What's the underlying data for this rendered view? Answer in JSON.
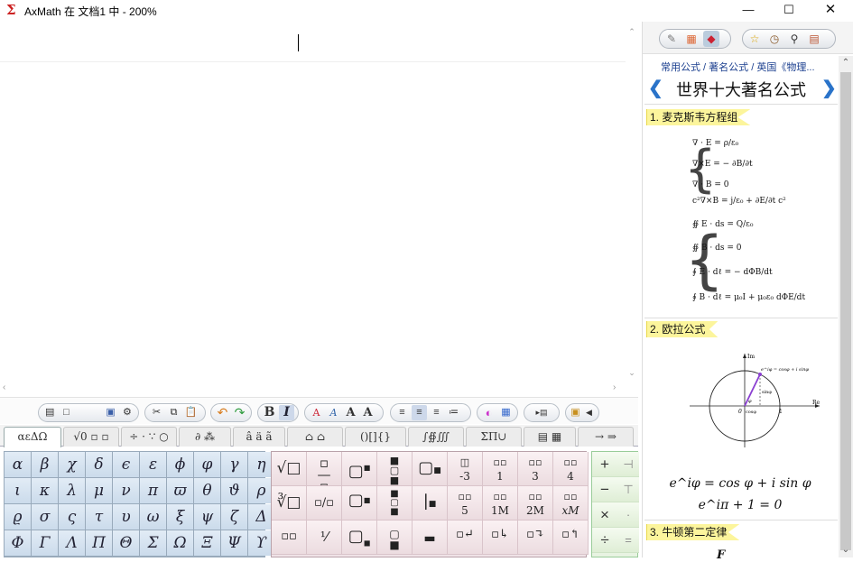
{
  "window": {
    "title": "AxMath 在 文档1 中 - 200%",
    "app_icon": "sigma-icon",
    "controls": [
      "minimize",
      "maximize",
      "close"
    ]
  },
  "toolbar": {
    "bold_label": "B",
    "italic_label": "I",
    "font_buttons": [
      "A",
      "A",
      "A",
      "A"
    ]
  },
  "tabs": [
    "αεΔΩ",
    "√0 ▫ ▫",
    "÷ · ∵ ○",
    "∂ ⁂",
    "â ä ã",
    "⌂ ⌂",
    "()[]{}",
    "∫∯∭",
    "ΣΠ∪",
    "▤ ▦",
    "→ ⇒"
  ],
  "greek": [
    [
      "α",
      "β",
      "χ",
      "δ",
      "ϵ",
      "ε",
      "ϕ",
      "φ",
      "γ",
      "η"
    ],
    [
      "ι",
      "κ",
      "λ",
      "μ",
      "ν",
      "π",
      "ϖ",
      "θ",
      "ϑ",
      "ρ"
    ],
    [
      "ϱ",
      "σ",
      "ς",
      "τ",
      "υ",
      "ω",
      "ξ",
      "ψ",
      "ζ",
      "Δ"
    ],
    [
      "Φ",
      "Γ",
      "Λ",
      "Π",
      "Θ",
      "Σ",
      "Ω",
      "Ξ",
      "Ψ",
      "ϒ"
    ]
  ],
  "templates": {
    "values": [
      "-3",
      "1",
      "3",
      "4",
      "5",
      "1M",
      "2M",
      "xM"
    ]
  },
  "operators": [
    "+",
    "−",
    "×",
    "÷"
  ],
  "panel": {
    "breadcrumb": "常用公式 / 著名公式 / 英国《物理...",
    "title": "世界十大著名公式",
    "sections": [
      "1. 麦克斯韦方程组",
      "2. 欧拉公式",
      "3. 牛顿第二定律"
    ],
    "maxwell": [
      "∇ · E = ρ/ε₀",
      "∇×E = − ∂B/∂t",
      "∇ · B = 0",
      "c²∇×B = j/ε₀ + ∂E/∂t c²"
    ],
    "maxwell_integral": [
      "∯ E · ds = Q/ε₀",
      "∯ B · ds = 0",
      "∮ E · dℓ = − dΦB/dt",
      "∮ B · dℓ = μ₀I + μ₀ε₀ dΦE/dt"
    ],
    "euler_diagram": {
      "im_label": "Im",
      "re_label": "Re",
      "origin": "0",
      "one": "1",
      "point_label": "e^iφ = cosφ + i sinφ",
      "cos_label": "cosφ",
      "sin_label": "sinφ",
      "angle_label": "φ"
    },
    "euler_eq1": "e^iφ = cos φ + i sin φ",
    "euler_eq2": "e^iπ + 1 = 0",
    "newton_partial": "F"
  },
  "colors": {
    "greek_bg": "#cbdbeb",
    "template_bg": "#ecdce0",
    "operator_bg": "#dfeed6",
    "section_bg": "#fcf59c",
    "link": "#1b3f8f",
    "nav_arrow": "#2a73c9",
    "diagram_vector": "#8a3fd1"
  }
}
